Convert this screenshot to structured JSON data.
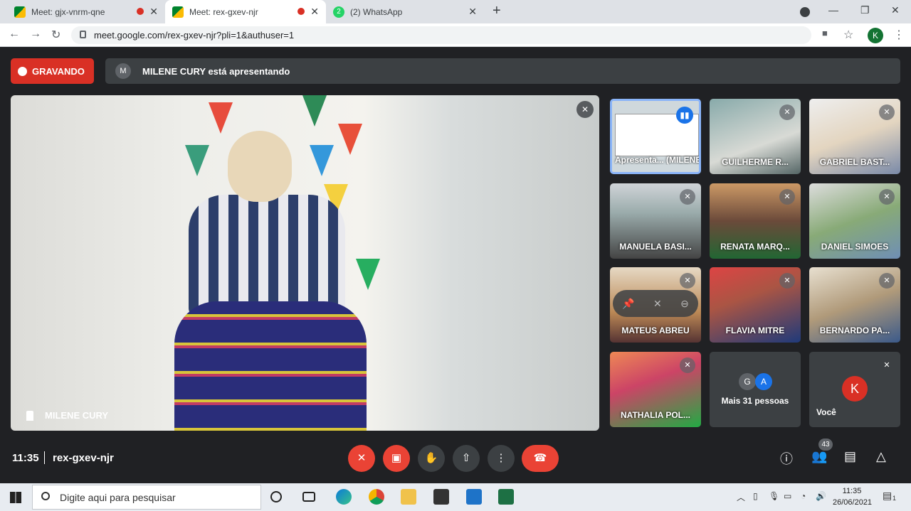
{
  "browser": {
    "tabs": [
      {
        "title": "Meet: gjx-vnrm-qne",
        "recording": true
      },
      {
        "title": "Meet: rex-gxev-njr",
        "recording": true
      },
      {
        "title": "(2) WhatsApp",
        "badge": "2"
      }
    ],
    "url": "meet.google.com/rex-gxev-njr?pli=1&authuser=1",
    "profile_initial": "K"
  },
  "meet": {
    "recording_label": "GRAVANDO",
    "presenter_initial": "M",
    "presenting_text": "MILENE CURY está apresentando",
    "main_speaker": "MILENE CURY",
    "tiles": [
      {
        "name": "Apresenta... (MILENE C..."
      },
      {
        "name": "GUILHERME R..."
      },
      {
        "name": "GABRIEL BAST..."
      },
      {
        "name": "MANUELA BASI..."
      },
      {
        "name": "RENATA MARQ..."
      },
      {
        "name": "DANIEL SIMOES"
      },
      {
        "name": "MATEUS ABREU"
      },
      {
        "name": "FLAVIA MITRE"
      },
      {
        "name": "BERNARDO PA..."
      },
      {
        "name": "NATHALIA POL..."
      }
    ],
    "more_people": {
      "initials": [
        "G",
        "A"
      ],
      "label": "Mais 31 pessoas"
    },
    "self": {
      "initial": "K",
      "label": "Você"
    },
    "time": "11:35",
    "meeting_code": "rex-gxev-njr",
    "participants_count": "43"
  },
  "taskbar": {
    "search_placeholder": "Digite aqui para pesquisar",
    "clock_time": "11:35",
    "clock_date": "26/06/2021",
    "notification_count": "1"
  },
  "colors": {
    "record_red": "#d93025",
    "accent_blue": "#8ab4f8",
    "dark_bg": "#202124"
  }
}
